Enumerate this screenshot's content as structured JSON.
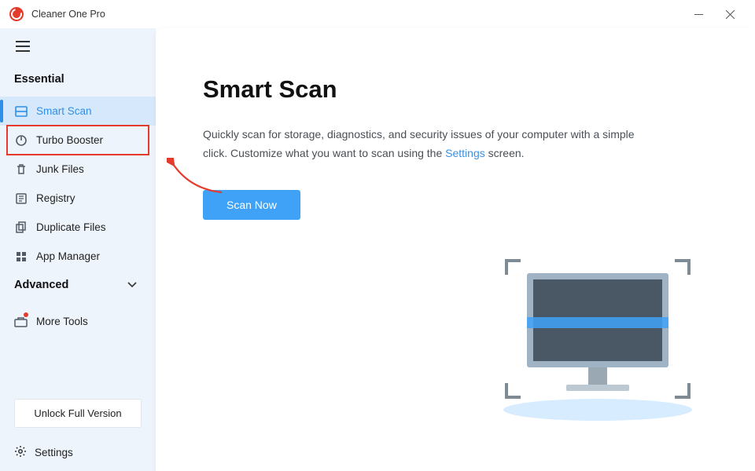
{
  "app": {
    "title": "Cleaner One Pro"
  },
  "sidebar": {
    "section_essential": "Essential",
    "section_advanced": "Advanced",
    "items": [
      {
        "label": "Smart Scan",
        "icon": "scan-icon"
      },
      {
        "label": "Turbo Booster",
        "icon": "power-icon"
      },
      {
        "label": "Junk Files",
        "icon": "trash-icon"
      },
      {
        "label": "Registry",
        "icon": "registry-icon"
      },
      {
        "label": "Duplicate Files",
        "icon": "duplicate-icon"
      },
      {
        "label": "App Manager",
        "icon": "apps-icon"
      }
    ],
    "more_tools": "More Tools",
    "unlock": "Unlock Full Version",
    "settings": "Settings"
  },
  "main": {
    "title": "Smart Scan",
    "desc_before": "Quickly scan for storage, diagnostics, and security issues of your computer with a simple click. Customize what you want to scan using the ",
    "desc_link": "Settings",
    "desc_after": " screen.",
    "scan_button": "Scan Now"
  }
}
